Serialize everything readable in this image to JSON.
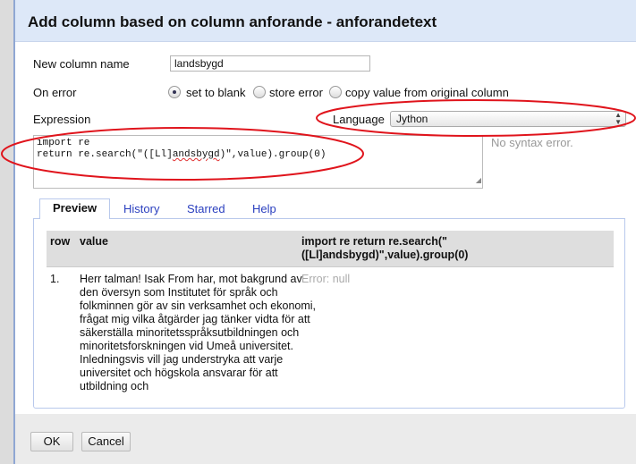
{
  "dialog": {
    "title": "Add column based on column anforande - anforandetext",
    "new_column_label": "New column name",
    "new_column_value": "landsbygd",
    "on_error_label": "On error",
    "on_error_options": [
      {
        "label": "set to blank",
        "selected": true
      },
      {
        "label": "store error",
        "selected": false
      },
      {
        "label": "copy value from original column",
        "selected": false
      }
    ],
    "expression_label": "Expression",
    "language_label": "Language",
    "language_value": "Jython",
    "expression_line1": "import re",
    "expression_line2_pre": "return re.search(\"([Ll]",
    "expression_line2_squig": "andsbygd",
    "expression_line2_post": ")\",value).group(0)",
    "syntax_status": "No syntax error.",
    "tabs": [
      "Preview",
      "History",
      "Starred",
      "Help"
    ],
    "active_tab": "Preview",
    "table": {
      "headers": [
        "row",
        "value",
        "import re return re.search(\" ([Ll]andsbygd)\",value).group(0)"
      ],
      "rows": [
        {
          "row": "1.",
          "value": "Herr talman! Isak From har, mot bakgrund av den översyn som Institutet för språk och folkminnen gör av sin verksamhet och ekonomi, frågat mig vilka åtgärder jag tänker vidta för att säkerställa minoritetsspråksutbildningen och minoritetsforskningen vid Umeå universitet. Inledningsvis vill jag understryka att varje universitet och högskola ansvarar för att utbildning och",
          "result": "Error: null"
        }
      ]
    },
    "ok_label": "OK",
    "cancel_label": "Cancel"
  },
  "colors": {
    "annotation": "#e0141c",
    "titlebar": "#dde8f8",
    "link": "#2a3fbf"
  }
}
